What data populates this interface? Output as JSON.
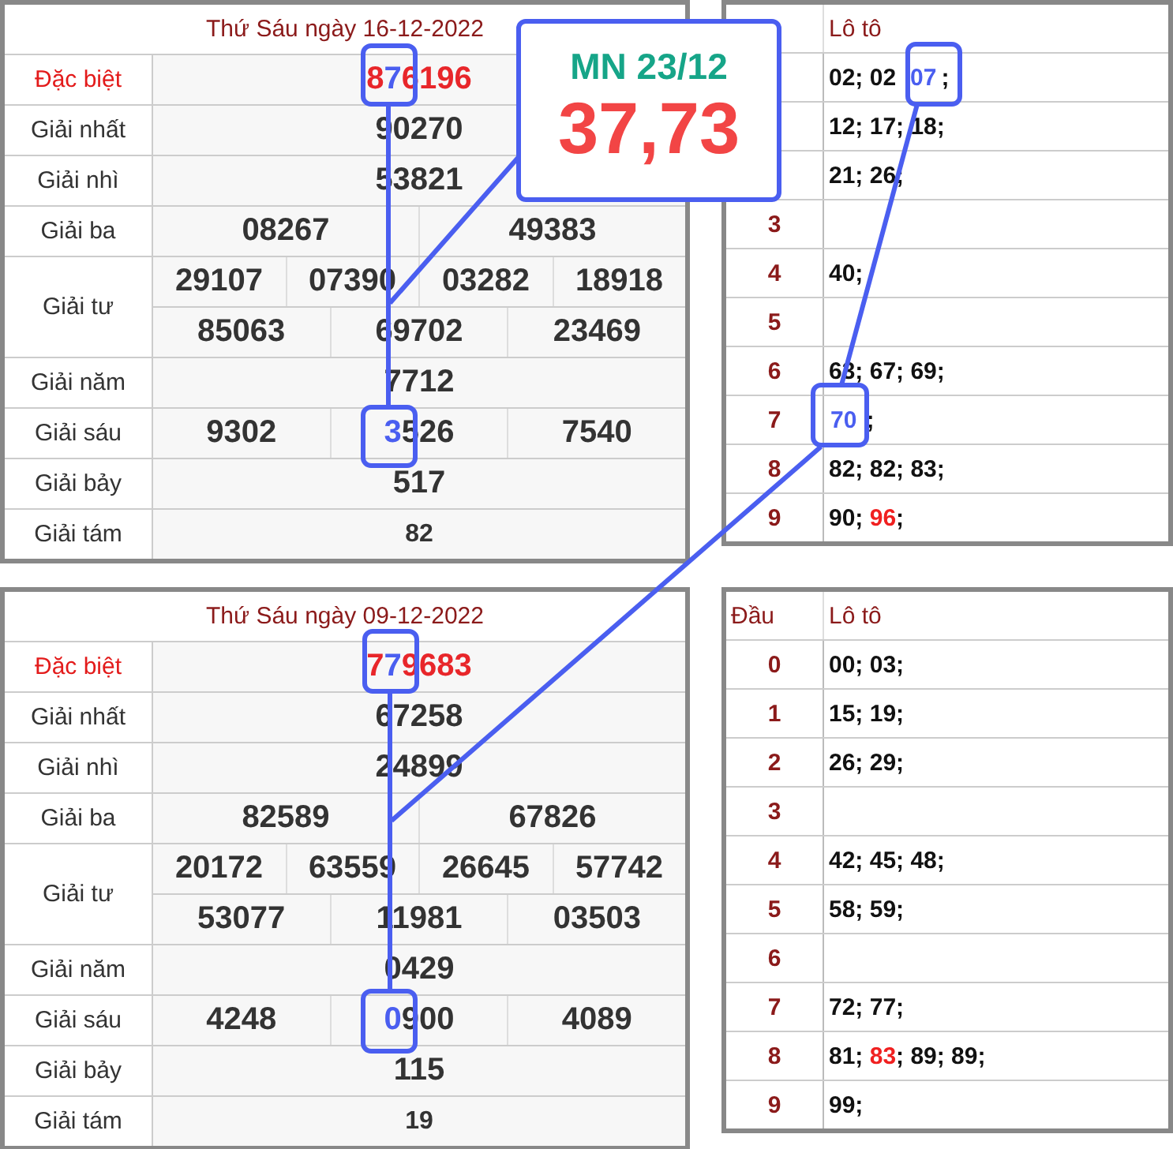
{
  "draws": [
    {
      "title": "Thứ Sáu ngày 16-12-2022",
      "prizes": [
        {
          "label": "Đặc biệt",
          "kind": "special",
          "rows": [
            [
              [
                {
                  "text": "8",
                  "highlight": false
                },
                {
                  "text": "7",
                  "highlight": true
                },
                {
                  "text": "6196",
                  "highlight": false
                }
              ]
            ]
          ]
        },
        {
          "label": "Giải nhất",
          "kind": "normal",
          "rows": [
            [
              [
                {
                  "text": "90270",
                  "highlight": false
                }
              ]
            ]
          ]
        },
        {
          "label": "Giải nhì",
          "kind": "normal",
          "rows": [
            [
              [
                {
                  "text": "53821",
                  "highlight": false
                }
              ]
            ]
          ]
        },
        {
          "label": "Giải ba",
          "kind": "normal",
          "rows": [
            [
              [
                {
                  "text": "08267",
                  "highlight": false
                }
              ],
              [
                {
                  "text": "49383",
                  "highlight": false
                }
              ]
            ]
          ]
        },
        {
          "label": "Giải tư",
          "kind": "normal",
          "rows": [
            [
              [
                {
                  "text": "29107",
                  "highlight": false
                }
              ],
              [
                {
                  "text": "07390",
                  "highlight": false
                }
              ],
              [
                {
                  "text": "03282",
                  "highlight": false
                }
              ],
              [
                {
                  "text": "18918",
                  "highlight": false
                }
              ]
            ],
            [
              [
                {
                  "text": "85063",
                  "highlight": false
                }
              ],
              [
                {
                  "text": "69702",
                  "highlight": false
                }
              ],
              [
                {
                  "text": "23469",
                  "highlight": false
                }
              ]
            ]
          ]
        },
        {
          "label": "Giải năm",
          "kind": "normal",
          "rows": [
            [
              [
                {
                  "text": "7712",
                  "highlight": false
                }
              ]
            ]
          ]
        },
        {
          "label": "Giải sáu",
          "kind": "normal",
          "rows": [
            [
              [
                {
                  "text": "9302",
                  "highlight": false
                }
              ],
              [
                {
                  "text": "3",
                  "highlight": true
                },
                {
                  "text": "526",
                  "highlight": false
                }
              ],
              [
                {
                  "text": "7540",
                  "highlight": false
                }
              ]
            ]
          ]
        },
        {
          "label": "Giải bảy",
          "kind": "normal",
          "rows": [
            [
              [
                {
                  "text": "517",
                  "highlight": false
                }
              ]
            ]
          ]
        },
        {
          "label": "Giải tám",
          "kind": "small",
          "rows": [
            [
              [
                {
                  "text": "82",
                  "highlight": false
                }
              ]
            ]
          ]
        }
      ],
      "loto": {
        "columns": [
          null,
          "Lô tô"
        ],
        "rows": [
          {
            "parts": [
              {
                "text": "02; 02",
                "kind": "plain"
              },
              {
                "text": "07",
                "kind": "highlight"
              },
              {
                "text": ";",
                "kind": "plain"
              }
            ]
          },
          {
            "parts": [
              {
                "text": "12; 17; 18;",
                "kind": "plain"
              }
            ]
          },
          {
            "parts": [
              {
                "text": "21; 26;",
                "kind": "plain"
              }
            ]
          },
          {
            "head": "3",
            "parts": []
          },
          {
            "head": "4",
            "parts": [
              {
                "text": "40;",
                "kind": "plain"
              }
            ]
          },
          {
            "head": "5",
            "parts": []
          },
          {
            "head": "6",
            "parts": [
              {
                "text": "63; 67; 69;",
                "kind": "plain"
              }
            ]
          },
          {
            "head": "7",
            "parts": [
              {
                "text": "70",
                "kind": "highlight"
              },
              {
                "text": ";",
                "kind": "plain"
              }
            ]
          },
          {
            "head": "8",
            "parts": [
              {
                "text": "82; 82; 83;",
                "kind": "plain"
              }
            ]
          },
          {
            "head": "9",
            "parts": [
              {
                "text": "90; ",
                "kind": "plain"
              },
              {
                "text": "96",
                "kind": "special"
              },
              {
                "text": ";",
                "kind": "plain"
              }
            ]
          }
        ]
      }
    },
    {
      "title": "Thứ Sáu ngày 09-12-2022",
      "prizes": [
        {
          "label": "Đặc biệt",
          "kind": "special",
          "rows": [
            [
              [
                {
                  "text": "7",
                  "highlight": false
                },
                {
                  "text": "7",
                  "highlight": true
                },
                {
                  "text": "9683",
                  "highlight": false
                }
              ]
            ]
          ]
        },
        {
          "label": "Giải nhất",
          "kind": "normal",
          "rows": [
            [
              [
                {
                  "text": "67258",
                  "highlight": false
                }
              ]
            ]
          ]
        },
        {
          "label": "Giải nhì",
          "kind": "normal",
          "rows": [
            [
              [
                {
                  "text": "24899",
                  "highlight": false
                }
              ]
            ]
          ]
        },
        {
          "label": "Giải ba",
          "kind": "normal",
          "rows": [
            [
              [
                {
                  "text": "82589",
                  "highlight": false
                }
              ],
              [
                {
                  "text": "67826",
                  "highlight": false
                }
              ]
            ]
          ]
        },
        {
          "label": "Giải tư",
          "kind": "normal",
          "rows": [
            [
              [
                {
                  "text": "20172",
                  "highlight": false
                }
              ],
              [
                {
                  "text": "63559",
                  "highlight": false
                }
              ],
              [
                {
                  "text": "26645",
                  "highlight": false
                }
              ],
              [
                {
                  "text": "57742",
                  "highlight": false
                }
              ]
            ],
            [
              [
                {
                  "text": "53077",
                  "highlight": false
                }
              ],
              [
                {
                  "text": "11981",
                  "highlight": false
                }
              ],
              [
                {
                  "text": "03503",
                  "highlight": false
                }
              ]
            ]
          ]
        },
        {
          "label": "Giải năm",
          "kind": "normal",
          "rows": [
            [
              [
                {
                  "text": "0429",
                  "highlight": false
                }
              ]
            ]
          ]
        },
        {
          "label": "Giải sáu",
          "kind": "normal",
          "rows": [
            [
              [
                {
                  "text": "4248",
                  "highlight": false
                }
              ],
              [
                {
                  "text": "0",
                  "highlight": true
                },
                {
                  "text": "900",
                  "highlight": false
                }
              ],
              [
                {
                  "text": "4089",
                  "highlight": false
                }
              ]
            ]
          ]
        },
        {
          "label": "Giải bảy",
          "kind": "normal",
          "rows": [
            [
              [
                {
                  "text": "115",
                  "highlight": false
                }
              ]
            ]
          ]
        },
        {
          "label": "Giải tám",
          "kind": "small",
          "rows": [
            [
              [
                {
                  "text": "19",
                  "highlight": false
                }
              ]
            ]
          ]
        }
      ],
      "loto": {
        "columns": [
          "Đầu",
          "Lô tô"
        ],
        "rows": [
          {
            "head": "0",
            "parts": [
              {
                "text": "00; 03;",
                "kind": "plain"
              }
            ]
          },
          {
            "head": "1",
            "parts": [
              {
                "text": "15; 19;",
                "kind": "plain"
              }
            ]
          },
          {
            "head": "2",
            "parts": [
              {
                "text": "26; 29;",
                "kind": "plain"
              }
            ]
          },
          {
            "head": "3",
            "parts": []
          },
          {
            "head": "4",
            "parts": [
              {
                "text": "42; 45; 48;",
                "kind": "plain"
              }
            ]
          },
          {
            "head": "5",
            "parts": [
              {
                "text": "58; 59;",
                "kind": "plain"
              }
            ]
          },
          {
            "head": "6",
            "parts": []
          },
          {
            "head": "7",
            "parts": [
              {
                "text": "72; 77;",
                "kind": "plain"
              }
            ]
          },
          {
            "head": "8",
            "parts": [
              {
                "text": "81; ",
                "kind": "plain"
              },
              {
                "text": "83",
                "kind": "special"
              },
              {
                "text": "; 89; 89;",
                "kind": "plain"
              }
            ]
          },
          {
            "head": "9",
            "parts": [
              {
                "text": "99;",
                "kind": "plain"
              }
            ]
          }
        ]
      }
    }
  ],
  "prediction": {
    "label": "MN 23/12",
    "numbers": "37,73"
  }
}
